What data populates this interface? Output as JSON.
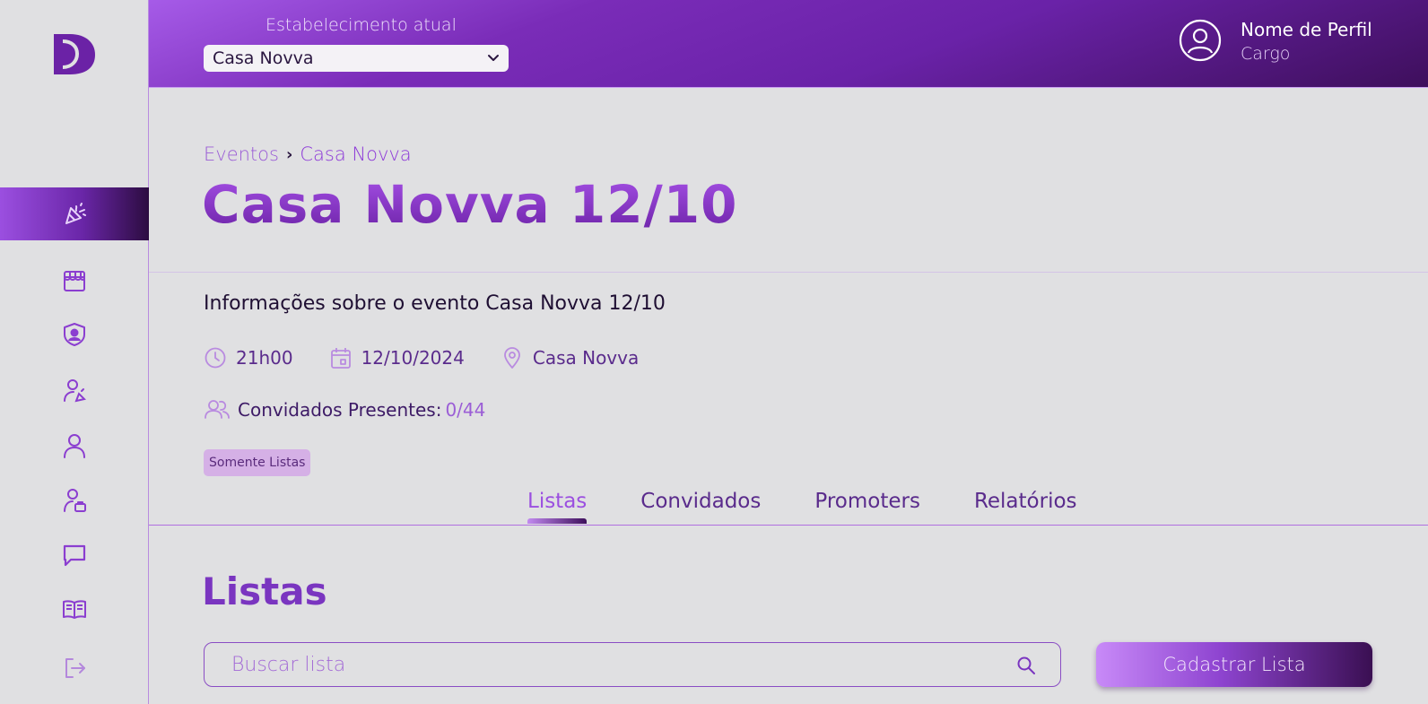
{
  "header": {
    "establishment_label": "Estabelecimento atual",
    "establishment_selected": "Casa Novva",
    "profile_name": "Nome de Perfil",
    "profile_role": "Cargo"
  },
  "sidebar": {
    "items": [
      {
        "name": "events",
        "icon": "party-popper-icon",
        "active": true
      },
      {
        "name": "establishments",
        "icon": "store-icon"
      },
      {
        "name": "security",
        "icon": "shield-user-icon"
      },
      {
        "name": "promoters",
        "icon": "user-party-icon"
      },
      {
        "name": "users",
        "icon": "user-icon"
      },
      {
        "name": "staff",
        "icon": "user-briefcase-icon"
      },
      {
        "name": "messages",
        "icon": "chat-icon"
      },
      {
        "name": "docs",
        "icon": "book-icon"
      },
      {
        "name": "logout",
        "icon": "logout-icon"
      }
    ]
  },
  "breadcrumb": {
    "root": "Eventos",
    "separator": "›",
    "current": "Casa Novva"
  },
  "page_title": "Casa Novva 12/10",
  "event": {
    "info_title": "Informações sobre o evento Casa Novva 12/10",
    "time": "21h00",
    "date": "12/10/2024",
    "location": "Casa Novva",
    "guests_label": "Convidados Presentes:",
    "guests_count": "0/44",
    "badge": "Somente Listas"
  },
  "tabs": [
    {
      "label": "Listas",
      "active": true
    },
    {
      "label": "Convidados"
    },
    {
      "label": "Promoters"
    },
    {
      "label": "Relatórios"
    }
  ],
  "lists_section": {
    "title": "Listas",
    "search_placeholder": "Buscar lista",
    "create_button": "Cadastrar Lista"
  },
  "colors": {
    "accent": "#8d3ad8",
    "accent_dark": "#3e0f5c",
    "background": "#e0e0e2"
  }
}
